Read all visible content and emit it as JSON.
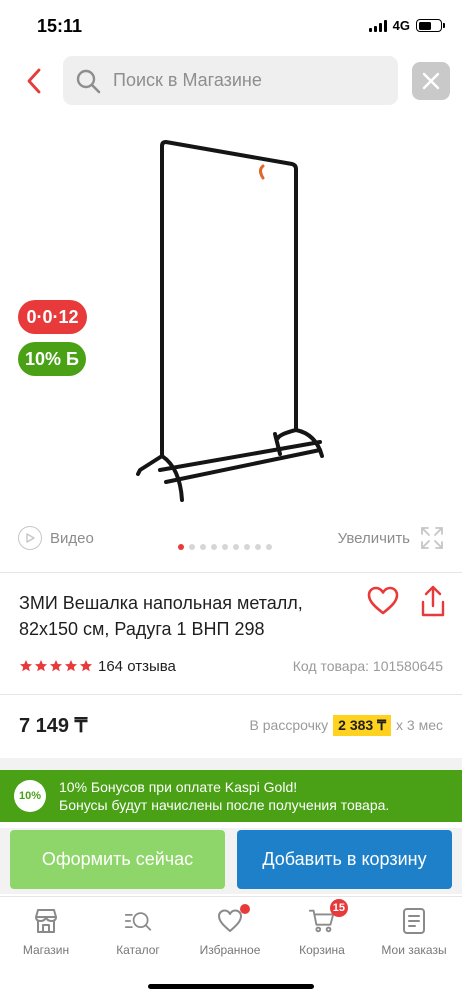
{
  "status_bar": {
    "time": "15:11",
    "network": "4G",
    "battery_level": 0.58
  },
  "search": {
    "placeholder": "Поиск в Магазине"
  },
  "gallery": {
    "installment_badge": "0·0·12",
    "bonus_badge": "10% Б",
    "video_label": "Видео",
    "zoom_label": "Увеличить",
    "dot_count": 9,
    "active_dot": 0
  },
  "product": {
    "title": "ЗМИ Вешалка напольная металл, 82x150 см, Радуга 1 ВНП 298",
    "rating": 5,
    "reviews": "164 отзыва",
    "sku": "Код товара: 101580645",
    "price": "7 149 ₸",
    "installment_prefix": "В рассрочку",
    "installment_amount": "2 383 ₸",
    "installment_suffix": "x 3 мес"
  },
  "bonus_banner": {
    "badge": "10%",
    "line1": "10% Бонусов при оплате Kaspi Gold!",
    "line2": "Бонусы будут начислены после получения товара."
  },
  "actions": {
    "buy_now": "Оформить сейчас",
    "add_to_cart": "Добавить в корзину"
  },
  "tabbar": {
    "items": [
      {
        "label": "Магазин",
        "icon": "shop-icon"
      },
      {
        "label": "Каталог",
        "icon": "catalog-search-icon"
      },
      {
        "label": "Избранное",
        "icon": "heart-icon"
      },
      {
        "label": "Корзина",
        "icon": "cart-icon",
        "badge": "15"
      },
      {
        "label": "Мои заказы",
        "icon": "orders-icon"
      }
    ]
  },
  "colors": {
    "accent_red": "#e83a3a",
    "bonus_green": "#4aa116",
    "buy_green": "#8fd66a",
    "cart_blue": "#1d80c9",
    "installment_yellow": "#ffd21f"
  }
}
